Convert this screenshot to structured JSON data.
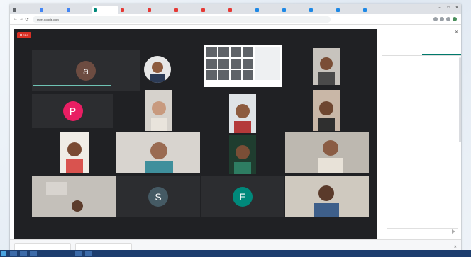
{
  "browser": {
    "tabs": [
      {
        "label": "",
        "color": "#5f6368",
        "active": false
      },
      {
        "label": "",
        "color": "#4285f4",
        "active": false
      },
      {
        "label": "",
        "color": "#4285f4",
        "active": false
      },
      {
        "label": "",
        "color": "#00897b",
        "active": true
      },
      {
        "label": "",
        "color": "#e53935",
        "active": false
      },
      {
        "label": "",
        "color": "#e53935",
        "active": false
      },
      {
        "label": "",
        "color": "#e53935",
        "active": false
      },
      {
        "label": "",
        "color": "#e53935",
        "active": false
      },
      {
        "label": "",
        "color": "#e53935",
        "active": false
      },
      {
        "label": "",
        "color": "#1e88e5",
        "active": false
      },
      {
        "label": "",
        "color": "#1e88e5",
        "active": false
      },
      {
        "label": "",
        "color": "#1e88e5",
        "active": false
      },
      {
        "label": "",
        "color": "#1e88e5",
        "active": false
      },
      {
        "label": "",
        "color": "#1e88e5",
        "active": false
      }
    ],
    "url": "meet.google.com"
  },
  "meeting": {
    "recording_label": "REC",
    "participants": [
      {
        "letter": "a",
        "color": "#6d4c41"
      },
      {
        "letter": "P",
        "color": "#e91e63"
      },
      {
        "letter": "S",
        "color": "#455a64"
      },
      {
        "letter": "E",
        "color": "#00897b"
      }
    ]
  },
  "side_panel": {
    "title": "",
    "tabs": [
      "",
      ""
    ],
    "messages": [
      {
        "sender": "",
        "text": ""
      },
      {
        "sender": "",
        "text": ""
      },
      {
        "sender": "",
        "text": ""
      },
      {
        "sender": "",
        "text": ""
      },
      {
        "sender": "",
        "text": ""
      },
      {
        "sender": "",
        "text": ""
      }
    ],
    "compose_placeholder": ""
  },
  "downloads": [
    {
      "name": ""
    },
    {
      "name": ""
    }
  ]
}
